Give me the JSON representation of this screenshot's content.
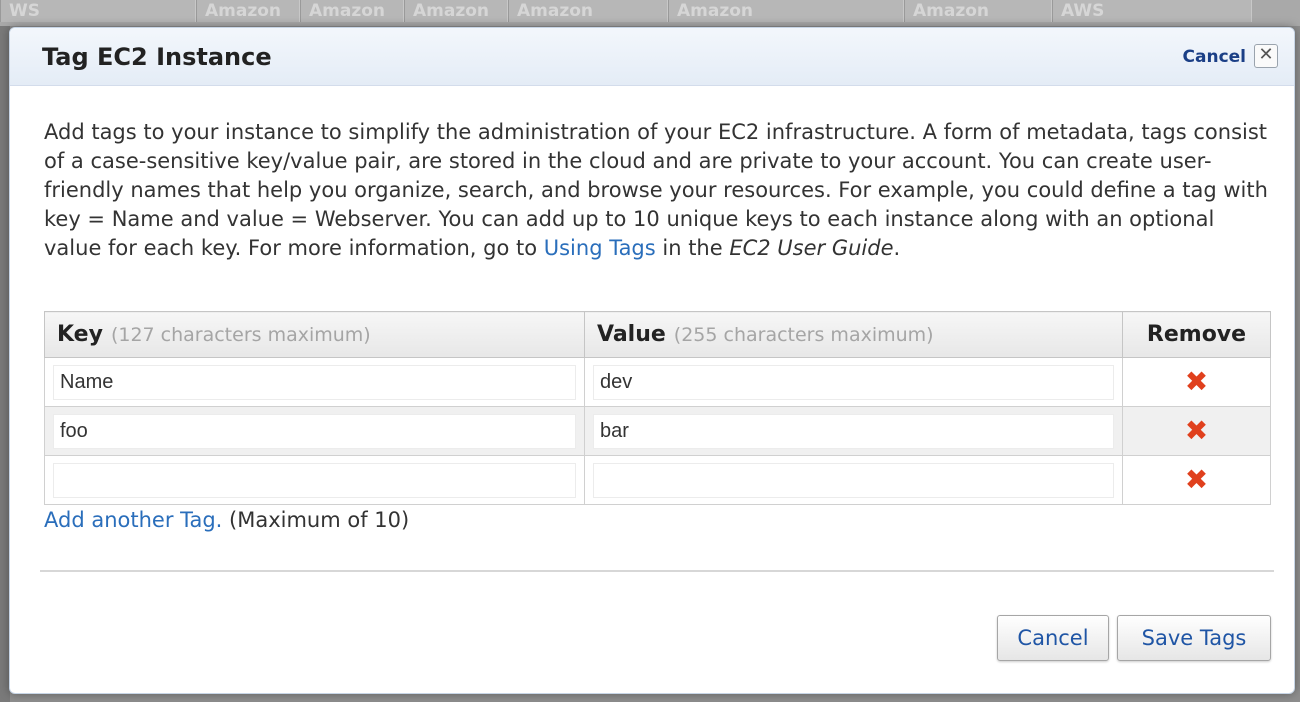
{
  "background": {
    "cells": [
      "WS",
      "Amazon",
      "Amazon",
      "Amazon",
      "Amazon",
      "Amazon",
      "Amazon",
      "AWS"
    ]
  },
  "modal": {
    "title": "Tag EC2 Instance",
    "header_cancel": "Cancel",
    "close_glyph": "✕"
  },
  "intro": {
    "text_before_link": "Add tags to your instance to simplify the administration of your EC2 infrastructure. A form of metadata, tags consist of a case-sensitive key/value pair, are stored in the cloud and are private to your account. You can create user-friendly names that help you organize, search, and browse your resources. For example, you could define a tag with key = Name and value = Webserver. You can add up to 10 unique keys to each instance along with an optional value for each key. For more information, go to ",
    "link_text": "Using Tags",
    "text_middle": " in the ",
    "guide_name": "EC2 User Guide",
    "text_end": "."
  },
  "table": {
    "key_header": "Key",
    "key_hint": "(127 characters maximum)",
    "value_header": "Value",
    "value_hint": "(255 characters maximum)",
    "remove_header": "Remove",
    "remove_glyph": "✖",
    "rows": [
      {
        "key": "Name",
        "value": "dev"
      },
      {
        "key": "foo",
        "value": "bar"
      },
      {
        "key": "",
        "value": ""
      }
    ]
  },
  "add_tag": {
    "link": "Add another Tag.",
    "note": " (Maximum of 10)"
  },
  "footer": {
    "cancel_label": "Cancel",
    "save_label": "Save Tags"
  },
  "colors": {
    "link": "#2a6ebb",
    "remove_icon": "#e0401d",
    "header_gradient_top": "#f3f7fc"
  }
}
